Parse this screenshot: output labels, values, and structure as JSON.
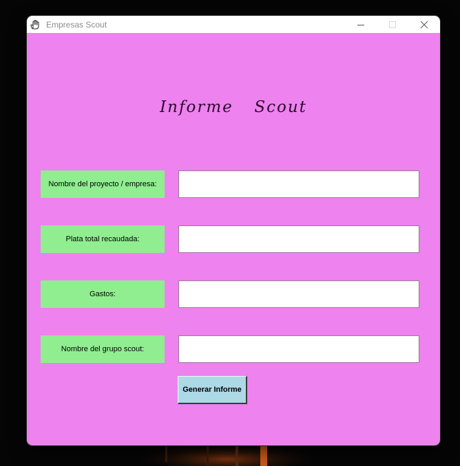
{
  "window": {
    "title": "Empresas Scout",
    "icon": "hand-icon"
  },
  "form": {
    "heading": "Informe  Scout",
    "fields": [
      {
        "label": "Nombre del proyecto / empresa:",
        "value": ""
      },
      {
        "label": "Plata total recaudada:",
        "value": ""
      },
      {
        "label": "Gastos:",
        "value": ""
      },
      {
        "label": "Nombre del grupo scout:",
        "value": ""
      }
    ],
    "submit_label": "Generar Informe"
  },
  "colors": {
    "background": "#ee82ee",
    "label_background": "#90ee90",
    "button_background": "#add8e6"
  }
}
